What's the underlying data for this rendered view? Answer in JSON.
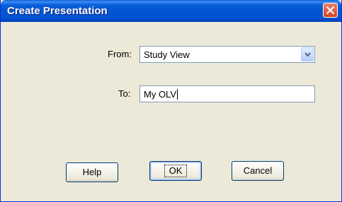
{
  "window": {
    "title": "Create Presentation"
  },
  "form": {
    "from_label": "From:",
    "from_value": "Study View",
    "to_label": "To:",
    "to_value": "My OLV"
  },
  "buttons": {
    "help": "Help",
    "ok": "OK",
    "cancel": "Cancel"
  },
  "icons": {
    "close": "close-icon",
    "dropdown": "chevron-down-icon"
  },
  "colors": {
    "titlebar": "#0454d3",
    "dialog_bg": "#ece9d8",
    "close_button": "#d24521",
    "field_border": "#7f9db9"
  }
}
